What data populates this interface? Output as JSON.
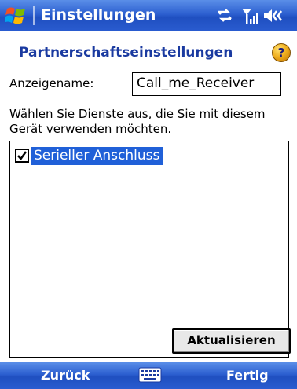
{
  "titlebar": {
    "title": "Einstellungen",
    "icons": [
      "windows-start-icon",
      "sync-icon",
      "signal-icon",
      "speaker-icon"
    ]
  },
  "header": {
    "title": "Partnerschaftseinstellungen",
    "help_icon": "?"
  },
  "form": {
    "name_label": "Anzeigename:",
    "name_value": "Call_me_Receiver",
    "description": "Wählen Sie Dienste aus, die Sie mit diesem Gerät verwenden möchten."
  },
  "services": [
    {
      "label": "Serieller Anschluss",
      "checked": true,
      "selected": true
    }
  ],
  "update_button": "Aktualisieren",
  "menubar": {
    "left": "Zurück",
    "right": "Fertig",
    "center_icon": "keyboard-icon"
  },
  "colors": {
    "titlebar": "#2c5fd0",
    "header_text": "#1a3aa0",
    "selection": "#2060d8"
  }
}
